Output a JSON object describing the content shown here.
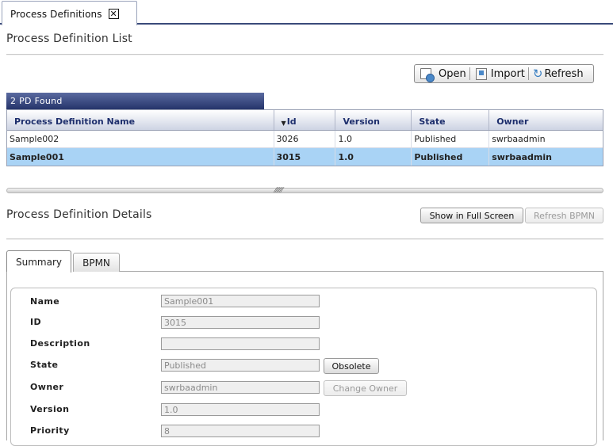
{
  "main_tab": {
    "label": "Process Definitions"
  },
  "list_section": {
    "title": "Process Definition List"
  },
  "toolbar": {
    "open_label": "Open",
    "import_label": "Import",
    "refresh_label": "Refresh"
  },
  "found_text": "2 PD Found",
  "table": {
    "columns": [
      "Process Definition Name",
      "Id",
      "Version",
      "State",
      "Owner"
    ],
    "rows": [
      [
        "Sample002",
        "3026",
        "1.0",
        "Published",
        "swrbaadmin"
      ],
      [
        "Sample001",
        "3015",
        "1.0",
        "Published",
        "swrbaadmin"
      ]
    ],
    "selected_row": 1,
    "sorted_column": "Id"
  },
  "details_section": {
    "title": "Process Definition Details",
    "fullscreen_label": "Show in Full Screen",
    "refresh_bpmn_label": "Refresh BPMN"
  },
  "detail_tabs": [
    "Summary",
    "BPMN"
  ],
  "form": {
    "fields": [
      {
        "label": "Name",
        "value": "Sample001"
      },
      {
        "label": "ID",
        "value": "3015"
      },
      {
        "label": "Description",
        "value": ""
      },
      {
        "label": "State",
        "value": "Published"
      },
      {
        "label": "Owner",
        "value": "swrbaadmin"
      },
      {
        "label": "Version",
        "value": "1.0"
      },
      {
        "label": "Priority",
        "value": "8"
      }
    ],
    "obsolete_label": "Obsolete",
    "change_owner_label": "Change Owner"
  }
}
